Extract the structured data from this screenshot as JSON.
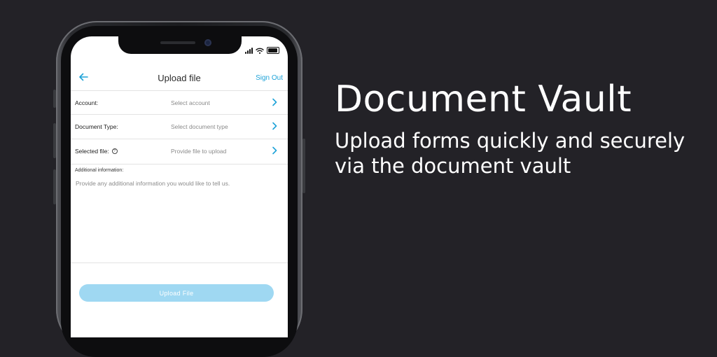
{
  "status_bar": {
    "signal_icon": "cellular-signal-icon",
    "wifi_icon": "wifi-icon",
    "battery_icon": "battery-icon"
  },
  "header": {
    "back_icon": "arrow-left-icon",
    "title": "Upload file",
    "sign_out_label": "Sign Out"
  },
  "form": {
    "rows": [
      {
        "label": "Account:",
        "value": "Select account",
        "has_help": false
      },
      {
        "label": "Document Type:",
        "value": "Select document type",
        "has_help": false
      },
      {
        "label": "Selected file:",
        "value": "Provide file to upload",
        "has_help": true
      }
    ],
    "additional_label": "Additional information:",
    "additional_placeholder": "Provide any additional information you would like to tell us."
  },
  "upload_button_label": "Upload File",
  "colors": {
    "accent": "#1fa3d8",
    "button_disabled": "#9fd8f2",
    "background": "#232227"
  },
  "hero": {
    "title": "Document Vault",
    "subtitle": "Upload forms quickly and securely via the document vault"
  }
}
